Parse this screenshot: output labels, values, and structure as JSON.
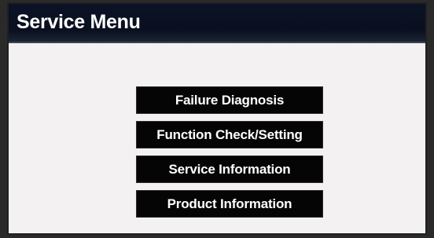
{
  "header": {
    "title": "Service Menu"
  },
  "menu": {
    "items": [
      {
        "label": "Failure Diagnosis"
      },
      {
        "label": "Function Check/Setting"
      },
      {
        "label": "Service Information"
      },
      {
        "label": "Product Information"
      }
    ]
  },
  "colors": {
    "header_bg": "#0b1226",
    "screen_bg": "#f3f1f1",
    "button_bg": "#050505",
    "button_text": "#ffffff"
  }
}
